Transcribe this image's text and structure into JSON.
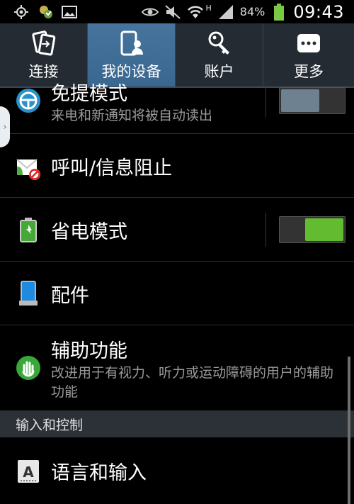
{
  "status_bar": {
    "icons": [
      "gps-icon",
      "contacts-sync-icon",
      "image-icon",
      "eye-icon",
      "mute-icon",
      "wifi-icon",
      "signal-icon",
      "battery-icon"
    ],
    "network_type": "H",
    "battery_percent": "84%",
    "time": "09:43"
  },
  "tabs": [
    {
      "label": "连接",
      "icon": "connections-icon",
      "active": false
    },
    {
      "label": "我的设备",
      "icon": "my-device-icon",
      "active": true
    },
    {
      "label": "账户",
      "icon": "accounts-icon",
      "active": false
    },
    {
      "label": "更多",
      "icon": "more-icon",
      "active": false
    }
  ],
  "rows": [
    {
      "title": "免提模式",
      "subtitle": "来电和新通知将被自动读出",
      "icon": "steering-wheel-icon",
      "toggle": "off"
    },
    {
      "title": "呼叫/信息阻止",
      "icon": "call-block-icon"
    },
    {
      "title": "省电模式",
      "icon": "power-saving-icon",
      "toggle": "on"
    },
    {
      "title": "配件",
      "icon": "accessory-icon"
    },
    {
      "title": "辅助功能",
      "subtitle": "改进用于有视力、听力或运动障碍的用户的辅助功能",
      "icon": "accessibility-hand-icon"
    }
  ],
  "section": {
    "label": "输入和控制"
  },
  "language_row": {
    "title": "语言和输入",
    "icon": "keyboard-a-icon"
  },
  "colors": {
    "accent": "#3a6790",
    "toggle_on": "#63bb2f",
    "toggle_off": "#6e8190"
  }
}
